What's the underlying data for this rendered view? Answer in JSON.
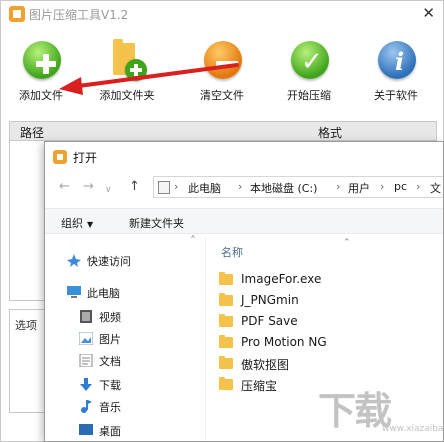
{
  "app": {
    "title": "图片压缩工具V1.2",
    "close": "✕",
    "toolbar": [
      {
        "label": "添加文件",
        "icon": "add-icon"
      },
      {
        "label": "添加文件夹",
        "icon": "add-folder-icon"
      },
      {
        "label": "清空文件",
        "icon": "clear-icon"
      },
      {
        "label": "开始压缩",
        "icon": "check-icon"
      },
      {
        "label": "关于软件",
        "icon": "info-icon"
      }
    ],
    "columns": {
      "path": "路径",
      "format": "格式"
    },
    "options_label": "选项"
  },
  "dialog": {
    "title": "打开",
    "breadcrumbs": [
      "此电脑",
      "本地磁盘 (C:)",
      "用户",
      "pc",
      "文"
    ],
    "commands": {
      "organize": "组织",
      "new_folder": "新建文件夹"
    },
    "nav": [
      {
        "label": "快速访问",
        "icon": "pin-icon"
      },
      {
        "label": "此电脑",
        "icon": "computer-icon"
      },
      {
        "label": "视频",
        "icon": "video-icon"
      },
      {
        "label": "图片",
        "icon": "pictures-icon"
      },
      {
        "label": "文档",
        "icon": "documents-icon"
      },
      {
        "label": "下载",
        "icon": "download-icon"
      },
      {
        "label": "音乐",
        "icon": "music-icon"
      },
      {
        "label": "桌面",
        "icon": "desktop-icon"
      }
    ],
    "column_name": "名称",
    "files": [
      "ImageFor.exe",
      "J_PNGmin",
      "PDF Save",
      "Pro Motion NG",
      "傲软抠图",
      "压缩宝"
    ]
  },
  "watermark": {
    "text": "下载",
    "sub": "www.xiazaiba.com"
  },
  "colors": {
    "accent_green": "#3ea51a",
    "accent_orange": "#e2760c",
    "accent_blue": "#2d6fb8",
    "arrow_red": "#d9201e",
    "folder_yellow": "#f5c24b"
  }
}
